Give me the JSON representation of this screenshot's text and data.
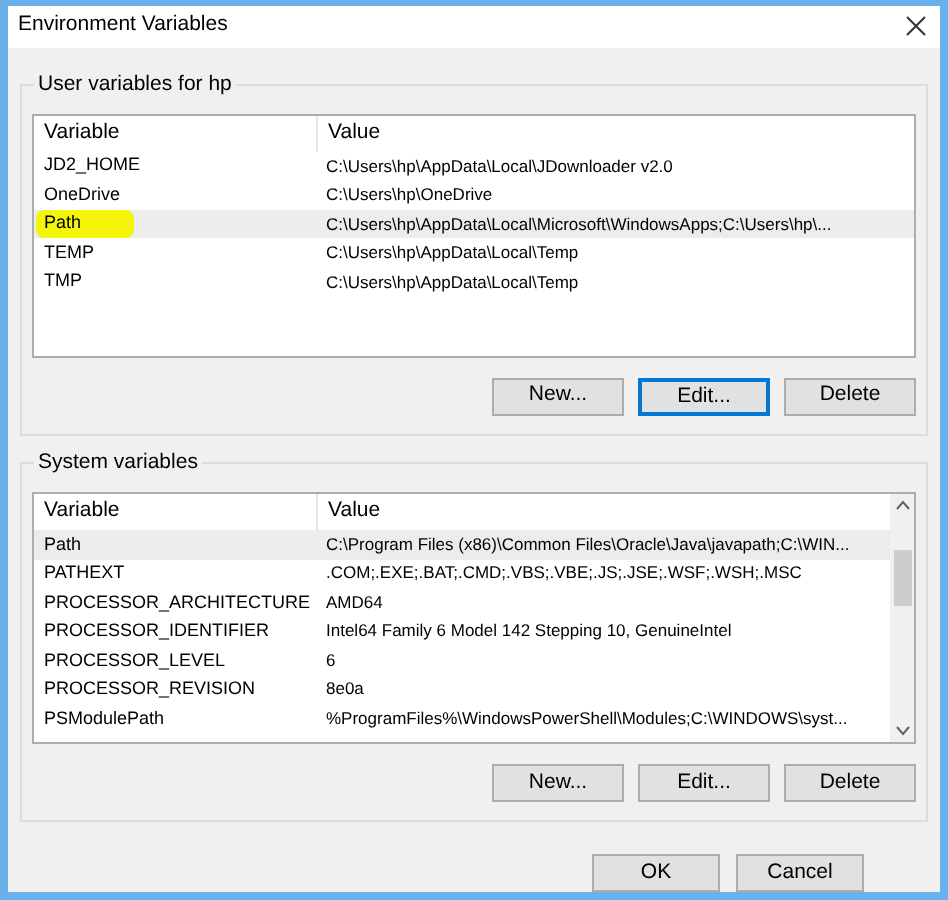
{
  "window": {
    "title": "Environment Variables"
  },
  "user_variables": {
    "title": "User variables for hp",
    "columns": [
      "Variable",
      "Value"
    ],
    "rows": [
      {
        "variable": "JD2_HOME",
        "value": "C:\\Users\\hp\\AppData\\Local\\JDownloader v2.0",
        "selected": false,
        "highlighted": false
      },
      {
        "variable": "OneDrive",
        "value": "C:\\Users\\hp\\OneDrive",
        "selected": false,
        "highlighted": false
      },
      {
        "variable": "Path",
        "value": "C:\\Users\\hp\\AppData\\Local\\Microsoft\\WindowsApps;C:\\Users\\hp\\...",
        "selected": true,
        "highlighted": true
      },
      {
        "variable": "TEMP",
        "value": "C:\\Users\\hp\\AppData\\Local\\Temp",
        "selected": false,
        "highlighted": false
      },
      {
        "variable": "TMP",
        "value": "C:\\Users\\hp\\AppData\\Local\\Temp",
        "selected": false,
        "highlighted": false
      }
    ],
    "buttons": [
      {
        "label": "New...",
        "focused": false
      },
      {
        "label": "Edit...",
        "focused": true
      },
      {
        "label": "Delete",
        "focused": false
      }
    ]
  },
  "system_variables": {
    "title": "System variables",
    "columns": [
      "Variable",
      "Value"
    ],
    "rows": [
      {
        "variable": "Path",
        "value": "C:\\Program Files (x86)\\Common Files\\Oracle\\Java\\javapath;C:\\WIN...",
        "selected": true,
        "highlighted": false
      },
      {
        "variable": "PATHEXT",
        "value": ".COM;.EXE;.BAT;.CMD;.VBS;.VBE;.JS;.JSE;.WSF;.WSH;.MSC",
        "selected": false,
        "highlighted": false
      },
      {
        "variable": "PROCESSOR_ARCHITECTURE",
        "value": "AMD64",
        "selected": false,
        "highlighted": false
      },
      {
        "variable": "PROCESSOR_IDENTIFIER",
        "value": "Intel64 Family 6 Model 142 Stepping 10, GenuineIntel",
        "selected": false,
        "highlighted": false
      },
      {
        "variable": "PROCESSOR_LEVEL",
        "value": "6",
        "selected": false,
        "highlighted": false
      },
      {
        "variable": "PROCESSOR_REVISION",
        "value": "8e0a",
        "selected": false,
        "highlighted": false
      },
      {
        "variable": "PSModulePath",
        "value": "%ProgramFiles%\\WindowsPowerShell\\Modules;C:\\WINDOWS\\syst...",
        "selected": false,
        "highlighted": false
      }
    ],
    "buttons": [
      {
        "label": "New...",
        "focused": false
      },
      {
        "label": "Edit...",
        "focused": false
      },
      {
        "label": "Delete",
        "focused": false
      }
    ]
  },
  "footer_buttons": [
    {
      "label": "OK",
      "focused": false
    },
    {
      "label": "Cancel",
      "focused": false
    }
  ]
}
